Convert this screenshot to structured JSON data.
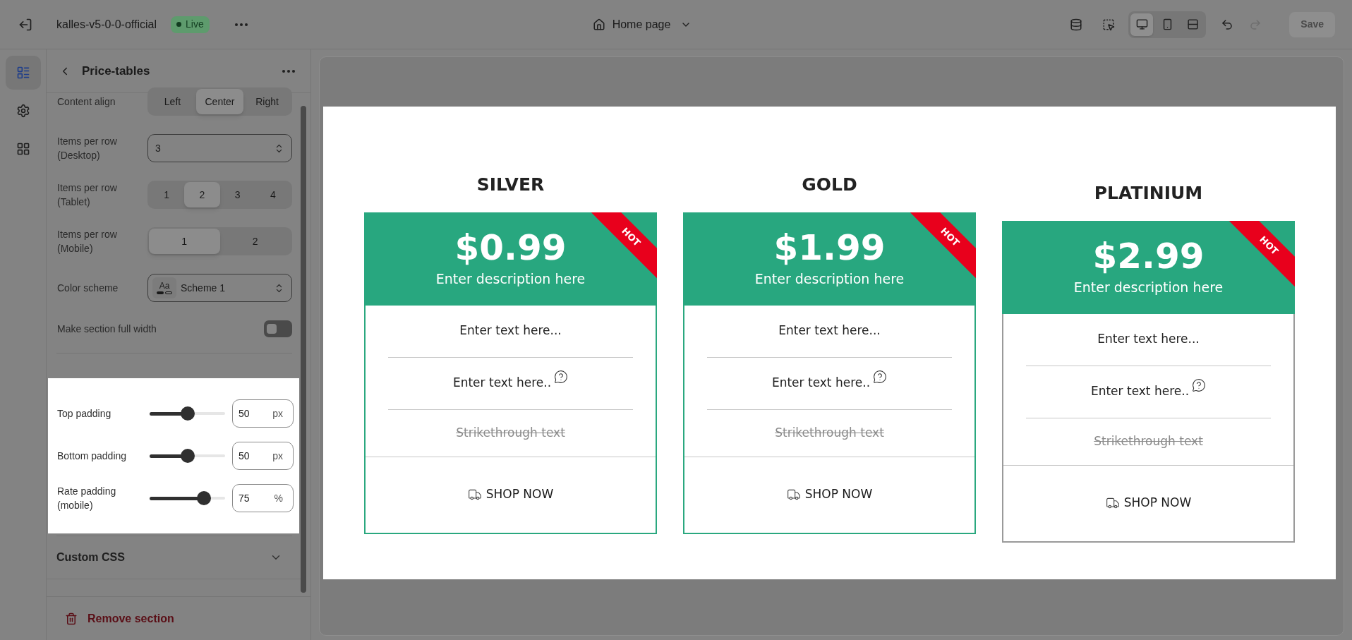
{
  "top_bar": {
    "store_name": "kalles-v5-0-0-official",
    "status_badge": "Live",
    "page_selector": "Home page",
    "view_modes": [
      {
        "selected": true
      },
      {
        "selected": false
      },
      {
        "selected": false
      }
    ],
    "redo_disabled": true,
    "save_button": {
      "label": "Save",
      "disabled": true
    }
  },
  "icon_rail": [
    {
      "selected": true
    },
    {
      "selected": false
    },
    {
      "selected": false
    }
  ],
  "sidebar": {
    "title": "Price-tables",
    "settings": [
      {
        "kind": "segmented",
        "label": "Content align",
        "options": [
          {
            "label": "Left",
            "selected": false
          },
          {
            "label": "Center",
            "selected": true
          },
          {
            "label": "Right",
            "selected": false
          }
        ]
      },
      {
        "kind": "select",
        "label": "Items per row (Desktop)",
        "value": "3"
      },
      {
        "kind": "segmented",
        "label": "Items per row (Tablet)",
        "options": [
          {
            "label": "1",
            "selected": false
          },
          {
            "label": "2",
            "selected": true
          },
          {
            "label": "3",
            "selected": false
          },
          {
            "label": "4",
            "selected": false
          }
        ]
      },
      {
        "kind": "segmented",
        "label": "Items per row (Mobile)",
        "options": [
          {
            "label": "1",
            "selected": true
          },
          {
            "label": "2",
            "selected": false
          }
        ]
      },
      {
        "kind": "select",
        "label": "Color scheme",
        "value": "Scheme 1",
        "swatch": "Aa"
      },
      {
        "kind": "toggle",
        "label": "Make section full width",
        "on": false
      }
    ],
    "padding_settings": [
      {
        "label": "Top padding",
        "level": 0.5,
        "value": "50",
        "unit": "px"
      },
      {
        "label": "Bottom padding",
        "level": 0.5,
        "value": "50",
        "unit": "px"
      },
      {
        "label": "Rate padding (mobile)",
        "level": 0.72,
        "value": "75",
        "unit": "%"
      }
    ],
    "custom_css": {
      "label": "Custom CSS",
      "expanded": false
    },
    "remove_button": "Remove section"
  },
  "preview": {
    "plans": [
      {
        "name": "SILVER",
        "price": "$0.99",
        "description": "Enter description here",
        "badge": "HOT",
        "color": "#2aa87f",
        "features": [
          {
            "kind": "plain",
            "text": "Enter text here..."
          },
          {
            "kind": "help",
            "text": "Enter text here.."
          },
          {
            "kind": "strike",
            "text": "Strikethrough text"
          }
        ],
        "button": "SHOP NOW"
      },
      {
        "name": "GOLD",
        "price": "$1.99",
        "description": "Enter description here",
        "badge": "HOT",
        "color": "#2aa87f",
        "features": [
          {
            "kind": "plain",
            "text": "Enter text here..."
          },
          {
            "kind": "help",
            "text": "Enter text here.."
          },
          {
            "kind": "strike",
            "text": "Strikethrough text"
          }
        ],
        "button": "SHOP NOW"
      },
      {
        "name": "PLATINIUM",
        "price": "$2.99",
        "description": "Enter description here",
        "badge": "HOT",
        "color": "#9a9a9a",
        "features": [
          {
            "kind": "plain",
            "text": "Enter text here..."
          },
          {
            "kind": "help",
            "text": "Enter text here.."
          },
          {
            "kind": "strike",
            "text": "Strikethrough text"
          }
        ],
        "button": "SHOP NOW"
      }
    ]
  }
}
